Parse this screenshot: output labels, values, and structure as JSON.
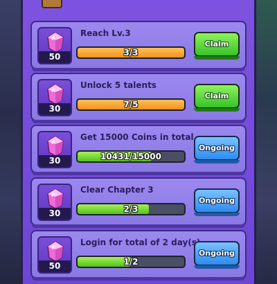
{
  "tasks": [
    {
      "title": "Reach Lv.3",
      "reward_amount": "50",
      "progress_text": "3/3",
      "progress_fraction": 1.0,
      "bar_color": "orange",
      "button_label": "Claim",
      "button_state": "claim"
    },
    {
      "title": "Unlock 5 talents",
      "reward_amount": "30",
      "progress_text": "7/5",
      "progress_fraction": 1.0,
      "bar_color": "orange",
      "button_label": "Claim",
      "button_state": "claim"
    },
    {
      "title": "Get 15000 Coins in total",
      "reward_amount": "30",
      "progress_text": "10431/15000",
      "progress_fraction": 0.695,
      "bar_color": "green",
      "button_label": "Ongoing",
      "button_state": "ongoing"
    },
    {
      "title": "Clear Chapter 3",
      "reward_amount": "30",
      "progress_text": "2/3",
      "progress_fraction": 0.667,
      "bar_color": "green",
      "button_label": "Ongoing",
      "button_state": "ongoing"
    },
    {
      "title": "Login for total of 2 day(s)",
      "reward_amount": "50",
      "progress_text": "1/2",
      "progress_fraction": 0.5,
      "bar_color": "green",
      "button_label": "Ongoing",
      "button_state": "ongoing"
    }
  ],
  "colors": {
    "panel": "#6d46d6",
    "card": "#8a78e4",
    "claim_green": "#38c228",
    "ongoing_blue": "#2d8bef",
    "gem_pink": "#f06ad8"
  },
  "icons": {
    "reward": "gem-icon",
    "header": "chest-icon"
  }
}
